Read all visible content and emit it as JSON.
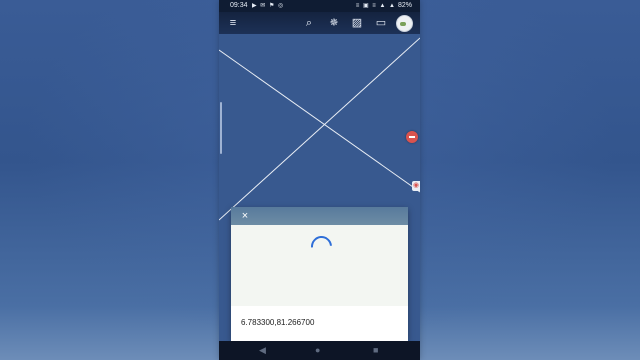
{
  "status_bar": {
    "time": "09:34",
    "notification_icons": "▶ ✉ ⚑ ◎",
    "system_icons": "≡ ▣ ≡ ▲ ▲",
    "battery": "82%"
  },
  "toolbar": {
    "menu_icon": "≡",
    "search_icon": "⌕",
    "settings_icon": "✵",
    "layers_icon": "▨",
    "ruler_icon": "▭"
  },
  "dialog": {
    "close_label": "×",
    "coordinates": "6.783300,81.266700"
  },
  "nav": {
    "back": "◀",
    "home": "●",
    "recents": "■"
  },
  "colors": {
    "map_background": "#38598f",
    "spinner": "#2f6fd8",
    "marker_red": "#d9534f"
  }
}
